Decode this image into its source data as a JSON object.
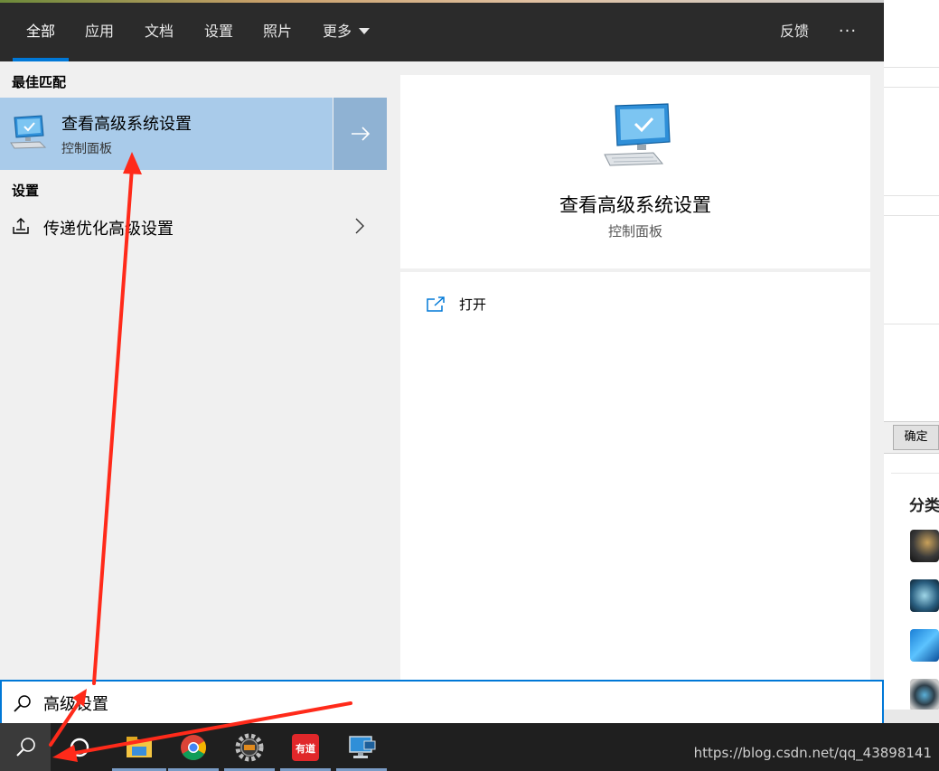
{
  "tabs": [
    {
      "label": "全部",
      "active": true
    },
    {
      "label": "应用"
    },
    {
      "label": "文档"
    },
    {
      "label": "设置"
    },
    {
      "label": "照片"
    },
    {
      "label": "更多"
    }
  ],
  "header_right": {
    "feedback": "反馈",
    "more": "···"
  },
  "best_match": {
    "section_title": "最佳匹配",
    "title": "查看高级系统设置",
    "subtitle": "控制面板",
    "icon": "monitor-check-icon"
  },
  "settings_section": {
    "section_title": "设置",
    "item_label": "传递优化高级设置",
    "icon": "upload-tray-icon"
  },
  "preview": {
    "title": "查看高级系统设置",
    "subtitle": "控制面板",
    "action_open": "打开"
  },
  "search": {
    "value": "高级设置",
    "icon": "search-icon"
  },
  "background_page": {
    "button_confirm": "确定",
    "panel_title": "分类"
  },
  "taskbar": {
    "items": [
      "search-icon",
      "cortana-icon",
      "file-explorer-icon",
      "chrome-icon",
      "gear-app-icon",
      "youdao-icon",
      "remote-desktop-icon"
    ],
    "youdao_text": "有道",
    "watermark": "https://blog.csdn.net/qq_43898141"
  },
  "colors": {
    "accent": "#0078d7",
    "tab_bar": "#2b2b2b",
    "selected_row": "#a9cbea",
    "annotation_arrow": "#ff2a1a"
  }
}
